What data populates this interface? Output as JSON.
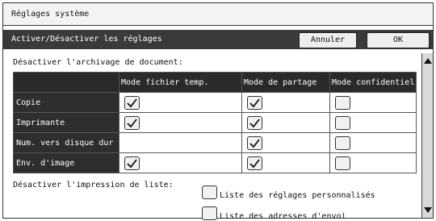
{
  "window": {
    "title": "Réglages système"
  },
  "toolbar": {
    "label": "Activer/Désactiver les réglages",
    "cancel_label": "Annuler",
    "ok_label": "OK"
  },
  "archive": {
    "section_label": "Désactiver l'archivage de document:",
    "columns": [
      "Mode fichier temp.",
      "Mode de partage",
      "Mode confidentiel"
    ],
    "rows": [
      {
        "label": "Copie",
        "cells": [
          true,
          true,
          false
        ]
      },
      {
        "label": "Imprimante",
        "cells": [
          true,
          true,
          false
        ]
      },
      {
        "label": "Num. vers disque dur",
        "cells": [
          null,
          true,
          false
        ]
      },
      {
        "label": "Env. d'image",
        "cells": [
          true,
          true,
          false
        ]
      }
    ]
  },
  "print_list": {
    "section_label": "Désactiver l'impression de liste:",
    "items": [
      {
        "label": "Liste des réglages personnalisés",
        "checked": false
      },
      {
        "label": "Liste des adresses d'envoi",
        "checked": false
      }
    ]
  }
}
